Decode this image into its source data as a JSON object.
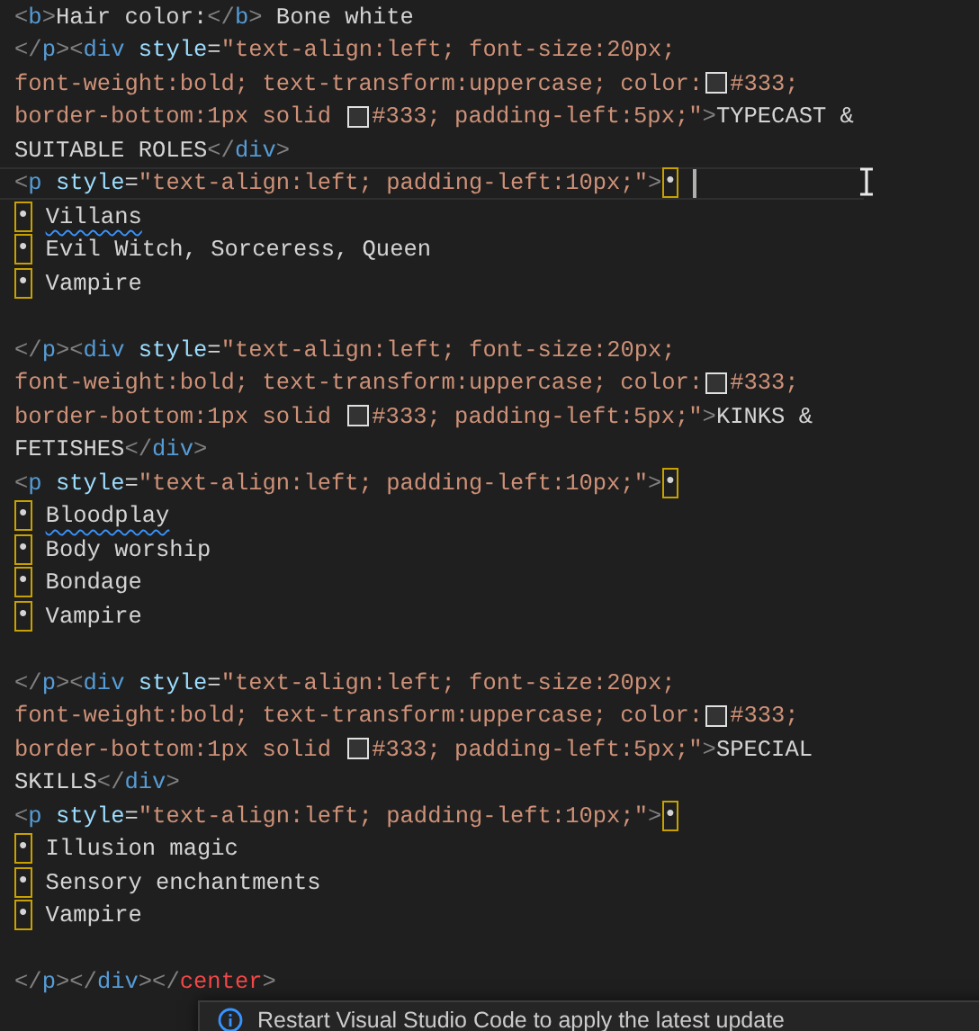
{
  "editor": {
    "lines": [
      {
        "kind": "code",
        "parts": [
          {
            "t": "<b>Hair color:</b> Bone white"
          }
        ]
      },
      {
        "kind": "code",
        "parts": [
          {
            "t": "</p><div style=\"text-align:left; font-size:20px;"
          }
        ]
      },
      {
        "kind": "code",
        "parts": [
          {
            "t": "font-weight:bold; text-transform:uppercase; color:"
          },
          {
            "t": "#333;"
          }
        ]
      },
      {
        "kind": "code",
        "parts": [
          {
            "t": "border-bottom:1px solid "
          },
          {
            "t": "#333; padding-left:5px;\">TYPECAST &"
          }
        ]
      },
      {
        "kind": "code",
        "parts": [
          {
            "t": "SUITABLE ROLES</div>"
          }
        ]
      },
      {
        "kind": "code",
        "current": true,
        "parts": [
          {
            "t": "<p style=\"text-align:left; padding-left:10px;\">•"
          }
        ]
      },
      {
        "kind": "code",
        "parts": [
          {
            "t": "• ",
            "misspelled": false
          },
          {
            "t": "Villans",
            "misspelled": true
          }
        ]
      },
      {
        "kind": "code",
        "parts": [
          {
            "t": "• Evil Witch, Sorceress, Queen"
          }
        ]
      },
      {
        "kind": "code",
        "parts": [
          {
            "t": "• Vampire"
          }
        ]
      },
      {
        "kind": "blank"
      },
      {
        "kind": "code",
        "parts": [
          {
            "t": "</p><div style=\"text-align:left; font-size:20px;"
          }
        ]
      },
      {
        "kind": "code",
        "parts": [
          {
            "t": "font-weight:bold; text-transform:uppercase; color:"
          },
          {
            "t": "#333;"
          }
        ]
      },
      {
        "kind": "code",
        "parts": [
          {
            "t": "border-bottom:1px solid "
          },
          {
            "t": "#333; padding-left:5px;\">KINKS &"
          }
        ]
      },
      {
        "kind": "code",
        "parts": [
          {
            "t": "FETISHES</div>"
          }
        ]
      },
      {
        "kind": "code",
        "parts": [
          {
            "t": "<p style=\"text-align:left; padding-left:10px;\">•"
          }
        ]
      },
      {
        "kind": "code",
        "parts": [
          {
            "t": "• ",
            "misspelled": false
          },
          {
            "t": "Bloodplay",
            "misspelled": true
          }
        ]
      },
      {
        "kind": "code",
        "parts": [
          {
            "t": "• Body worship"
          }
        ]
      },
      {
        "kind": "code",
        "parts": [
          {
            "t": "• Bondage"
          }
        ]
      },
      {
        "kind": "code",
        "parts": [
          {
            "t": "• Vampire"
          }
        ]
      },
      {
        "kind": "blank"
      },
      {
        "kind": "code",
        "parts": [
          {
            "t": "</p><div style=\"text-align:left; font-size:20px;"
          }
        ]
      },
      {
        "kind": "code",
        "parts": [
          {
            "t": "font-weight:bold; text-transform:uppercase; color:"
          },
          {
            "t": "#333;"
          }
        ]
      },
      {
        "kind": "code",
        "parts": [
          {
            "t": "border-bottom:1px solid "
          },
          {
            "t": "#333; padding-left:5px;\">SPECIAL"
          }
        ]
      },
      {
        "kind": "code",
        "parts": [
          {
            "t": "SKILLS</div>"
          }
        ]
      },
      {
        "kind": "code",
        "parts": [
          {
            "t": "<p style=\"text-align:left; padding-left:10px;\">•"
          }
        ]
      },
      {
        "kind": "code",
        "parts": [
          {
            "t": "• Illusion magic"
          }
        ]
      },
      {
        "kind": "code",
        "parts": [
          {
            "t": "• Sensory enchantments"
          }
        ]
      },
      {
        "kind": "code",
        "parts": [
          {
            "t": "• Vampire"
          }
        ]
      },
      {
        "kind": "blank"
      },
      {
        "kind": "code",
        "parts": [
          {
            "t": "</p></div></",
            "error": false
          },
          {
            "t": "center",
            "error": true
          },
          {
            "t": ">",
            "error": false
          }
        ]
      }
    ]
  },
  "notification": {
    "message": "Restart Visual Studio Code to apply the latest update"
  }
}
